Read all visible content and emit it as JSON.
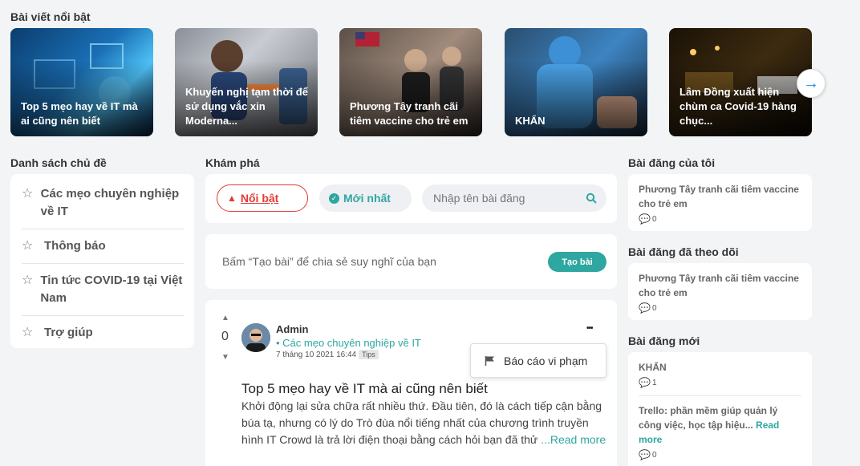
{
  "featured": {
    "heading": "Bài viết nổi bật",
    "items": [
      {
        "title": "Top 5 mẹo hay về IT mà ai cũng nên biết"
      },
      {
        "title": "Khuyến nghị tạm thời để sử dụng vắc xin Moderna..."
      },
      {
        "title": "Phương Tây tranh cãi tiêm vaccine cho trẻ em"
      },
      {
        "title": "KHẨN"
      },
      {
        "title": "Lâm Đồng xuất hiện chùm ca Covid-19 hàng chục..."
      }
    ]
  },
  "topics": {
    "heading": "Danh sách chủ đề",
    "items": [
      {
        "label": "Các mẹo chuyên nghiệp về IT"
      },
      {
        "label": "Thông báo"
      },
      {
        "label": "Tin tức COVID-19 tại Việt Nam"
      },
      {
        "label": "Trợ giúp"
      }
    ]
  },
  "explore": {
    "heading": "Khám phá",
    "tab_featured": "Nổi bật",
    "tab_newest": "Mới nhất",
    "search_placeholder": "Nhập tên bài đăng"
  },
  "composer": {
    "prompt": "Bấm “Tạo bài” để chia sẻ suy nghĩ của bạn",
    "create_label": "Tạo bài"
  },
  "post": {
    "votes": "0",
    "author": "Admin",
    "topic": "• Các mẹo chuyên nghiệp về IT",
    "date": "7 tháng 10 2021 16:44",
    "tag": "Tips",
    "menu_dots": "•••",
    "report_label": "Báo cáo vi phạm",
    "title": "Top 5 mẹo hay về IT mà ai cũng nên biết",
    "excerpt": "Khởi động lại sửa chữa rất nhiều thứ. Đầu tiên, đó là cách tiếp cận bằng búa tạ, nhưng có lý do Trò đùa nổi tiếng nhất của chương trình truyền hình IT Crowd là trả lời điện thoại bằng cách hỏi bạn đã thử ",
    "read_more": "...Read more"
  },
  "my_posts": {
    "heading": "Bài đăng của tôi",
    "title": "Phương Tây tranh cãi tiêm vaccine cho trẻ em",
    "comments": "0"
  },
  "followed_posts": {
    "heading": "Bài đăng đã theo dõi",
    "title": "Phương Tây tranh cãi tiêm vaccine cho trẻ em",
    "comments": "0"
  },
  "new_posts": {
    "heading": "Bài đăng mới",
    "items": [
      {
        "title": "KHẨN",
        "comments": "1"
      },
      {
        "title": "Trello: phần mềm giúp quản lý công việc, học tập hiệu...",
        "read_more": "Read more",
        "comments": "0"
      }
    ]
  },
  "colors": {
    "accent": "#2ea7a0",
    "danger": "#e53935",
    "arrow": "#1e88e5"
  }
}
